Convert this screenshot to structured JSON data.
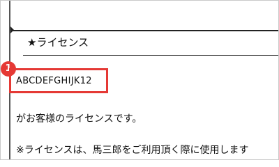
{
  "section": {
    "heading": "★ライセンス"
  },
  "callout": {
    "badge_number": "1",
    "accent_color": "#e53935"
  },
  "license": {
    "key": "ABCDEFGHIJK12"
  },
  "body": {
    "line1": "がお客様のライセンスです。",
    "line2": "※ライセンスは、馬三郎をご利用頂く際に使用します"
  }
}
